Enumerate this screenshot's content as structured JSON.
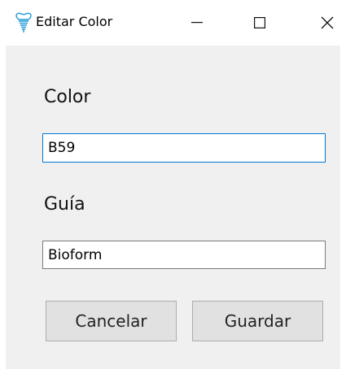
{
  "window": {
    "title": "Editar Color",
    "app_icon": "tooth-icon",
    "controls": {
      "minimize": "minimize-icon",
      "maximize": "maximize-icon",
      "close": "close-icon"
    }
  },
  "form": {
    "color_label": "Color",
    "color_value": "B59",
    "guia_label": "Guía",
    "guia_value": "Bioform"
  },
  "actions": {
    "cancel_label": "Cancelar",
    "save_label": "Guardar"
  },
  "colors": {
    "focus_border": "#0078d7",
    "client_background": "#f0f0f0",
    "button_background": "#e1e1e1",
    "icon_accent": "#1e9bd7"
  }
}
